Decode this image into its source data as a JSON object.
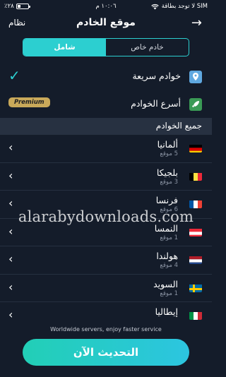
{
  "status_bar": {
    "carrier": "لا توجد بطاقة SIM",
    "time": "١٠:٠٦ م",
    "battery_label": "٪٢٨",
    "battery_level": 0.28
  },
  "header": {
    "title": "موقع الخادم",
    "left_label": "نظام",
    "back_icon": "arrow-right-icon"
  },
  "tabs": {
    "all": "شامل",
    "private": "خادم خاص",
    "active": "all"
  },
  "quick_rows": {
    "fast_servers": "خوادم سريعة",
    "fastest_servers": "أسرع الخوادم",
    "premium_badge": "Premium"
  },
  "section": {
    "all_servers": "جميع الخوادم"
  },
  "servers": [
    {
      "name": "ألمانيا",
      "count": "5 موقع"
    },
    {
      "name": "بلجيكا",
      "count": "3 موقع"
    },
    {
      "name": "فرنسا",
      "count": "6 موقع"
    },
    {
      "name": "النمسا",
      "count": "1 موقع"
    },
    {
      "name": "هولندا",
      "count": "4 موقع"
    },
    {
      "name": "السويد",
      "count": "1 موقع"
    },
    {
      "name": "إيطاليا",
      "count": ""
    }
  ],
  "footer": {
    "note": "Worldwide servers, enjoy faster service",
    "button": "التحديث الآن"
  },
  "watermark": "alarabydownloads.com",
  "colors": {
    "accent": "#2ccfd0",
    "background": "#141c2a",
    "premium": "#c9a95a"
  }
}
